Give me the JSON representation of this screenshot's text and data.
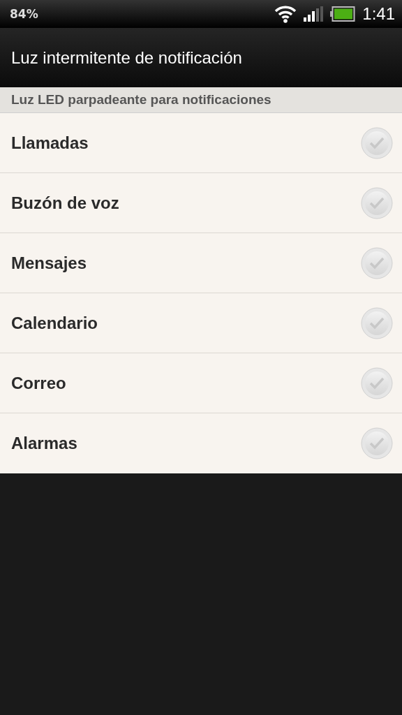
{
  "status_bar": {
    "battery_percent": "84%",
    "time": "1:41"
  },
  "title": "Luz intermitente de notificación",
  "section": {
    "header": "Luz LED parpadeante para notificaciones",
    "items": [
      {
        "label": "Llamadas",
        "checked": false
      },
      {
        "label": "Buzón de voz",
        "checked": false
      },
      {
        "label": "Mensajes",
        "checked": false
      },
      {
        "label": "Calendario",
        "checked": false
      },
      {
        "label": "Correo",
        "checked": false
      },
      {
        "label": "Alarmas",
        "checked": false
      }
    ]
  }
}
